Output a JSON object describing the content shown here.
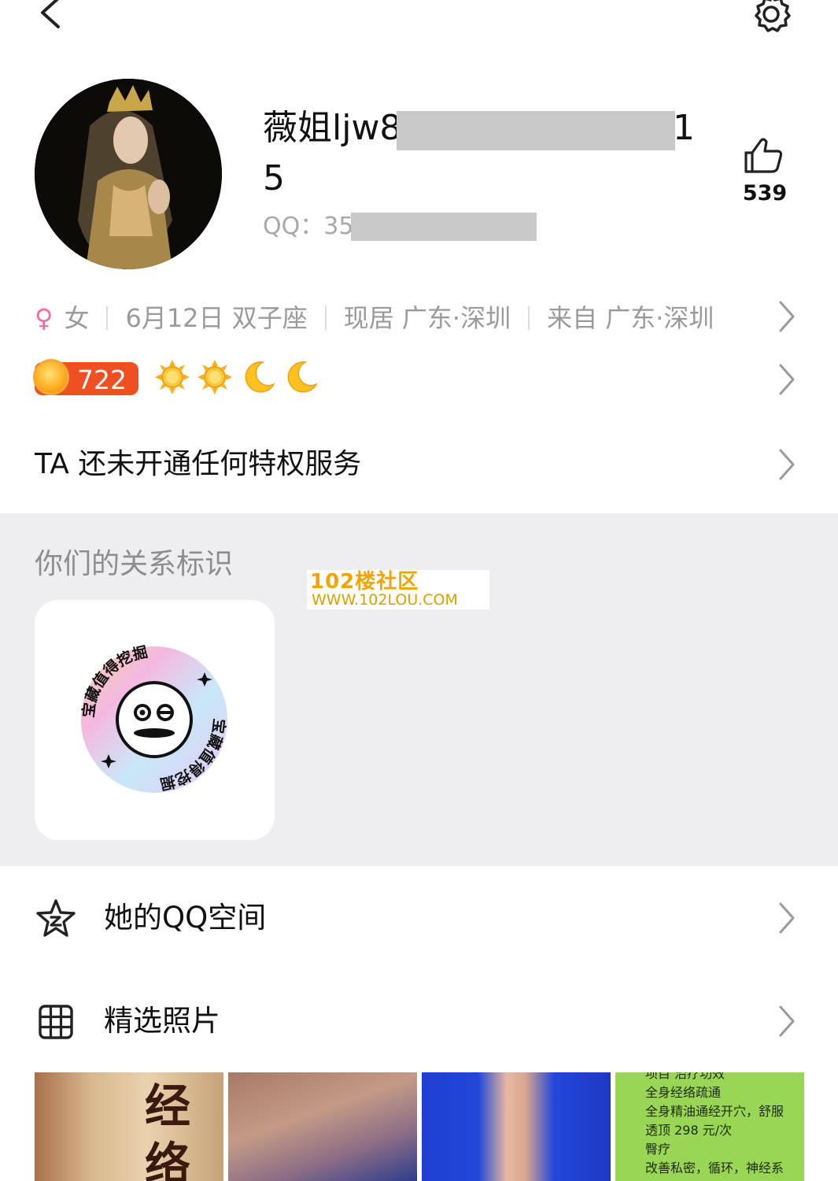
{
  "profile": {
    "name_part1": "薇姐ljw8",
    "name_part2": "1",
    "name_line2": "5",
    "qq_label": "QQ：",
    "qq_prefix": "35",
    "likes": "539"
  },
  "info": {
    "gender_symbol": "♀",
    "gender": "女",
    "birthday": "6月12日 双子座",
    "current_location": "现居 广东·深圳",
    "hometown": "来自 广东·深圳"
  },
  "level": {
    "number": "722"
  },
  "privilege": {
    "text": "TA 还未开通任何特权服务"
  },
  "relation": {
    "title": "你们的关系标识",
    "badge_text_top": "宝藏值得挖掘",
    "badge_text_bottom": "宝藏值得挖掘"
  },
  "watermark": {
    "line1": "102楼社区",
    "line2": "WWW.102LOU.COM"
  },
  "menu": {
    "qzone_label": "她的QQ空间",
    "photos_label": "精选照片"
  },
  "photos": {
    "p1_chars": [
      "经",
      "络"
    ],
    "p4_lines": [
      "项目          治疗功效",
      "全身经络疏通",
      "全身精油通经开穴，舒服",
      "透顶 298 元/次",
      "臀疗",
      "改善私密，循环，神经系"
    ]
  },
  "colors": {
    "accent_level": "#f04e23",
    "female": "#f06aa8",
    "section_bg": "#eeeef1",
    "muted_text": "#9a9a9a"
  },
  "icons": {
    "back": "chevron-left-icon",
    "settings": "gear-icon",
    "like": "thumbs-up-icon",
    "qzone": "qzone-star-icon",
    "photos": "grid-icon"
  }
}
